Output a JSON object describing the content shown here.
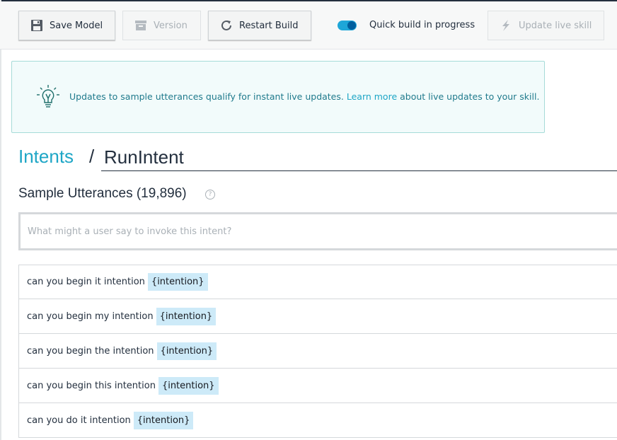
{
  "toolbar": {
    "save_label": "Save Model",
    "version_label": "Version",
    "restart_label": "Restart Build",
    "quick_build_label": "Quick build in progress",
    "update_live_label": "Update live skill"
  },
  "banner": {
    "text_before": "Updates to sample utterances qualify for instant live updates. ",
    "link": "Learn more",
    "text_after": " about live updates to your skill."
  },
  "breadcrumb": {
    "parent": "Intents",
    "separator": "/",
    "intent_name": "RunIntent"
  },
  "utterances": {
    "title": "Sample Utterances (19,896)",
    "help": "?",
    "placeholder": "What might a user say to invoke this intent?",
    "rows": [
      {
        "text": "can you begin it intention",
        "slot": "{intention}"
      },
      {
        "text": "can you begin my intention",
        "slot": "{intention}"
      },
      {
        "text": "can you begin the intention",
        "slot": "{intention}"
      },
      {
        "text": "can you begin this intention",
        "slot": "{intention}"
      },
      {
        "text": "can you do it intention",
        "slot": "{intention}"
      }
    ]
  },
  "icons": {
    "save": "save-icon",
    "version": "archive-icon",
    "restart": "refresh-icon",
    "update": "lightning-icon",
    "banner": "lightbulb-icon",
    "help": "help-icon"
  },
  "colors": {
    "accent": "#1ea6c6",
    "toggle_on": "#1ea6d8",
    "slot_highlight": "#cdeaf8",
    "banner_bg": "#f2fbfb"
  }
}
